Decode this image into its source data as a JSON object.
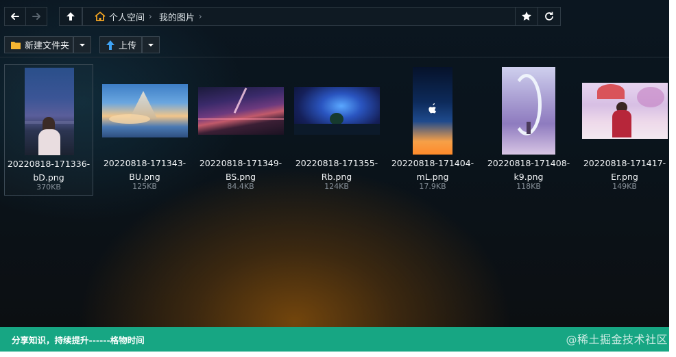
{
  "nav": {
    "back_icon": "arrow-left-icon",
    "forward_icon": "arrow-right-icon",
    "up_icon": "arrow-up-icon",
    "star_icon": "star-icon",
    "refresh_icon": "refresh-icon"
  },
  "breadcrumb": {
    "home_icon": "home-icon",
    "items": [
      {
        "label": "个人空间"
      },
      {
        "label": "我的图片"
      }
    ]
  },
  "toolbar": {
    "new_folder_label": "新建文件夹",
    "upload_label": "上传"
  },
  "files": [
    {
      "name_line1": "20220818-171336-",
      "name_line2": "bD.png",
      "size": "370KB"
    },
    {
      "name_line1": "20220818-171343-",
      "name_line2": "BU.png",
      "size": "125KB"
    },
    {
      "name_line1": "20220818-171349-",
      "name_line2": "BS.png",
      "size": "84.4KB"
    },
    {
      "name_line1": "20220818-171355-",
      "name_line2": "Rb.png",
      "size": "124KB"
    },
    {
      "name_line1": "20220818-171404-",
      "name_line2": "mL.png",
      "size": "17.9KB"
    },
    {
      "name_line1": "20220818-171408-",
      "name_line2": "k9.png",
      "size": "118KB"
    },
    {
      "name_line1": "20220818-171417-",
      "name_line2": "Er.png",
      "size": "149KB"
    }
  ],
  "footer": {
    "text": "分享知识，持续提升------格物时间",
    "watermark": "@稀土掘金技术社区"
  },
  "colors": {
    "footer_bg": "#17a683",
    "window_bg": "#0b1620"
  }
}
